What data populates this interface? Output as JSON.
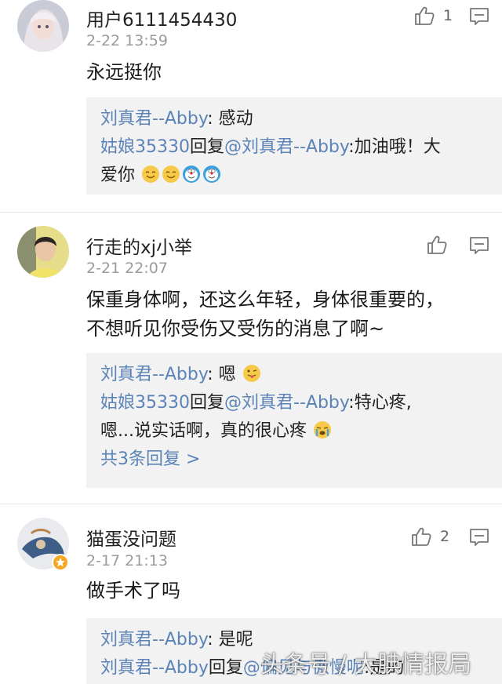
{
  "comments": [
    {
      "username": "用户6111454430",
      "time": "2-22 13:59",
      "likes": "1",
      "content_lines": [
        "永远挺你"
      ],
      "replies": [
        {
          "name": "刘真君--Abby",
          "text": ": 感动"
        },
        {
          "name": "姑娘35330",
          "mid": "回复",
          "at": "@刘真君--Abby",
          "text": ":加油哦！大",
          "text2": "爱你"
        }
      ]
    },
    {
      "username": "行走的xj小举",
      "time": "2-21 22:07",
      "likes": "",
      "content_lines": [
        "保重身体啊，还这么年轻，身体很重要的，",
        "不想听见你受伤又受伤的消息了啊~"
      ],
      "replies": [
        {
          "name": "刘真君--Abby",
          "text": ": 嗯"
        },
        {
          "name": "姑娘35330",
          "mid": "回复",
          "at": "@刘真君--Abby",
          "text": ":特心疼,",
          "text2": "嗯...说实话啊，真的很心疼"
        }
      ],
      "more": "共3条回复 >"
    },
    {
      "username": "猫蛋没问题",
      "time": "2-17 21:13",
      "likes": "2",
      "content_lines": [
        "做手术了吗"
      ],
      "replies": [
        {
          "name": "刘真君--Abby",
          "text": ": 是呢"
        },
        {
          "name": "刘真君--Abby",
          "mid": "回复",
          "at": "@偏见与傲慢呢",
          "text": ":是的"
        }
      ]
    }
  ],
  "watermark": "头条号 / 大腆情报局",
  "icons": {
    "like": "thumbs-up-icon",
    "reply": "reply-icon",
    "verified": "verified-badge-icon"
  },
  "colors": {
    "link": "#5b83b8",
    "reply_bg": "#f2f2f2",
    "time": "#9b9b9b"
  }
}
